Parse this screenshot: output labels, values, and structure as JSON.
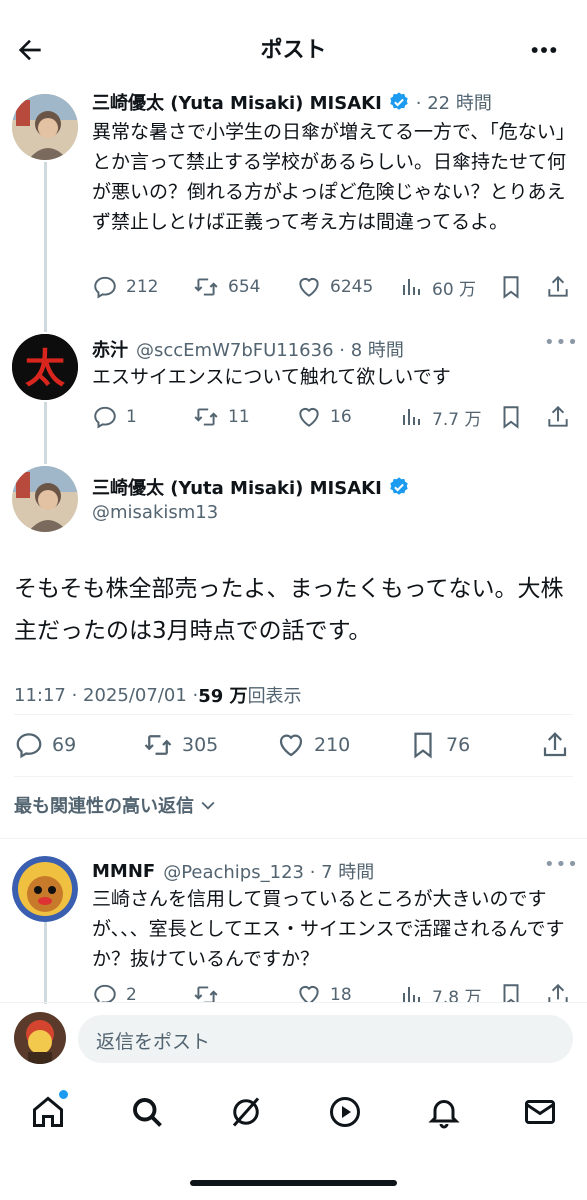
{
  "header": {
    "title": "ポスト"
  },
  "tweets": [
    {
      "name": "三崎優太 (Yuta Misaki) MISAKI",
      "time": "· 22 時間",
      "text": "異常な暑さで小学生の日傘が増えてる一方で、「危ない」とか言って禁止する学校があるらしい。日傘持たせて何が悪いの？倒れる方がよっぽど危険じゃない？とりあえず禁止しとけば正義って考え方は間違ってるよ。",
      "replies": "212",
      "retweets": "654",
      "likes": "6245",
      "views": "60 万"
    },
    {
      "name": "赤汁",
      "handle": "@sccEmW7bFU11636 · 8 時間",
      "text": "エスサイエンスについて触れて欲しいです",
      "replies": "1",
      "retweets": "11",
      "likes": "16",
      "views": "7.7 万"
    }
  ],
  "main_tweet": {
    "name": "三崎優太 (Yuta Misaki) MISAKI",
    "handle": "@misakism13",
    "text": "そもそも株全部売ったよ、まったくもってない。大株主だったのは3月時点での話です。",
    "timestamp": "11:17 · 2025/07/01 · ",
    "views_count": "59 万",
    "views_label": "回表示",
    "replies": "69",
    "retweets": "305",
    "likes": "210",
    "bookmarks": "76"
  },
  "sort_label": "最も関連性の高い返信",
  "reply_tweet": {
    "name": "MMNF",
    "handle": "@Peachips_123 · 7 時間",
    "text": "三崎さんを信用して買っているところが大きいのですが、、、室長としてエス・サイエンスで活躍されるんですか？抜けているんですか？",
    "replies": "2",
    "retweets": "",
    "likes": "18",
    "views": "7.8 万"
  },
  "composer": {
    "placeholder": "返信をポスト"
  },
  "colors": {
    "verified": "#1d9bf0",
    "accent_dot": "#1d9bf0",
    "muted": "#536471"
  }
}
